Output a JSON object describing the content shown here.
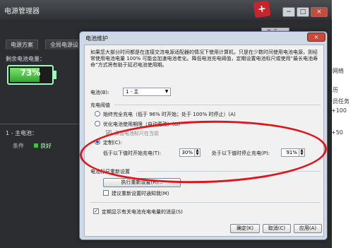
{
  "background_right": {
    "line1": "分网络",
    "line2": "日历",
    "line3": "会员任务",
    "line4": "+100",
    "line5": "+50"
  },
  "power_manager": {
    "title": "电源管理器",
    "logo_text": "+",
    "minimize_label": "−",
    "restore_label": "□",
    "close_label": "×",
    "topright_button": "关 于 ...",
    "tabs": [
      "电源方案",
      "全局电源设"
    ],
    "remaining_label": "剩余电池电量：",
    "battery_percent": "73%",
    "battery_level": 0.73,
    "main_battery_label": "1 - 主电池：",
    "condition_label": "条件",
    "condition_value": "良好"
  },
  "dialog": {
    "title": "电池维护",
    "close_label": "×",
    "description": "如果您大部分时间都是在连接交流电源适配器的情况下使用计算机，只是在少数时间使用电池电源，则经常使用电池电量 100% 可能会加速电池老化。降低电池充电阈值，定期设置电池标尺或使用“最长电池寿命”方式将有助于延迟电池使用期。",
    "battery_label": "电池(B):",
    "battery_selected": "1 - 主",
    "charge_threshold_heading": "充电阈值",
    "option_full": "始终完全充电（低于 96% 时开始；处于 100% 时停止）(A)",
    "option_optimize": "优化电池使用期限（自动更改）(O)",
    "option_hidden_partial": "满值电池标尺在当前",
    "option_custom": "定制(C):",
    "start_label": "低于以下值时开始充电(T):",
    "start_value": "30%",
    "stop_label": "处于以下值时停止充电(P):",
    "stop_value": "91%",
    "recalibrate_heading": "电池标尺重新设置",
    "recalibrate_button": "执行重新设置(R)...",
    "recalibrate_notify": "建议重新设置时通知我(M)",
    "show_message": "定期显示有关电池充电电量的消息(S)",
    "ok_button": "确定(K)",
    "cancel_button": "取消(C)",
    "apply_button": "应用(A)"
  },
  "colors": {
    "annotation": "#e0151a",
    "battery_fill": "#2fa52b",
    "dialog_frame": "#cfd9e6"
  }
}
